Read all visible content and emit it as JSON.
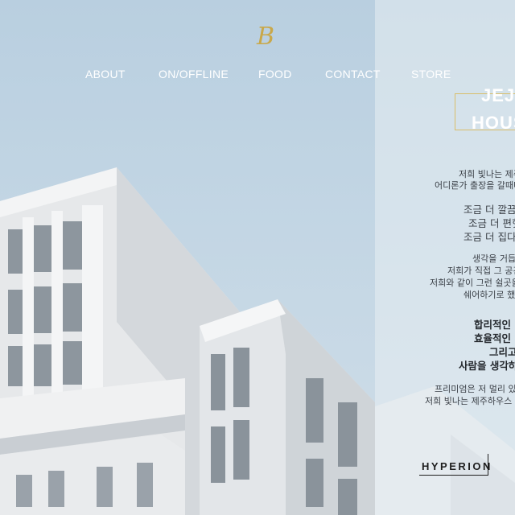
{
  "logo": {
    "text": "B"
  },
  "nav": {
    "items": [
      {
        "label": "ABOUT"
      },
      {
        "label": "ON/OFFLINE"
      },
      {
        "label": "FOOD"
      },
      {
        "label": "CONTACT"
      },
      {
        "label": "STORE"
      }
    ]
  },
  "hero": {
    "title_line1": "JEJU",
    "title_line2": "HOUS"
  },
  "intro": {
    "lines": [
      "저희 빛나는 제주",
      "어디론가 출장을 갈때마"
    ]
  },
  "para1": {
    "lines": [
      "조금 더 깔끔",
      "조금 더 편힛",
      "조금 더 집다"
    ]
  },
  "para2": {
    "lines": [
      "생각을 거듭",
      "저희가 직접 그 공긴",
      "저희와 같이 그런 쉴곳을",
      "쉐어하기로 했"
    ]
  },
  "para3": {
    "lines": [
      "합리적인 ",
      "효율적인 ",
      "그리고",
      "사람을 생각하"
    ]
  },
  "para4": {
    "lines": [
      "프리미엄은 저 멀리 있",
      "저희 빛나는 제주하우스"
    ]
  },
  "brand": {
    "hyperion": "HYPERION"
  },
  "colors": {
    "accent_gold": "#c9a84a",
    "sky": "#c3d6e4",
    "nav_text": "#ffffff"
  }
}
